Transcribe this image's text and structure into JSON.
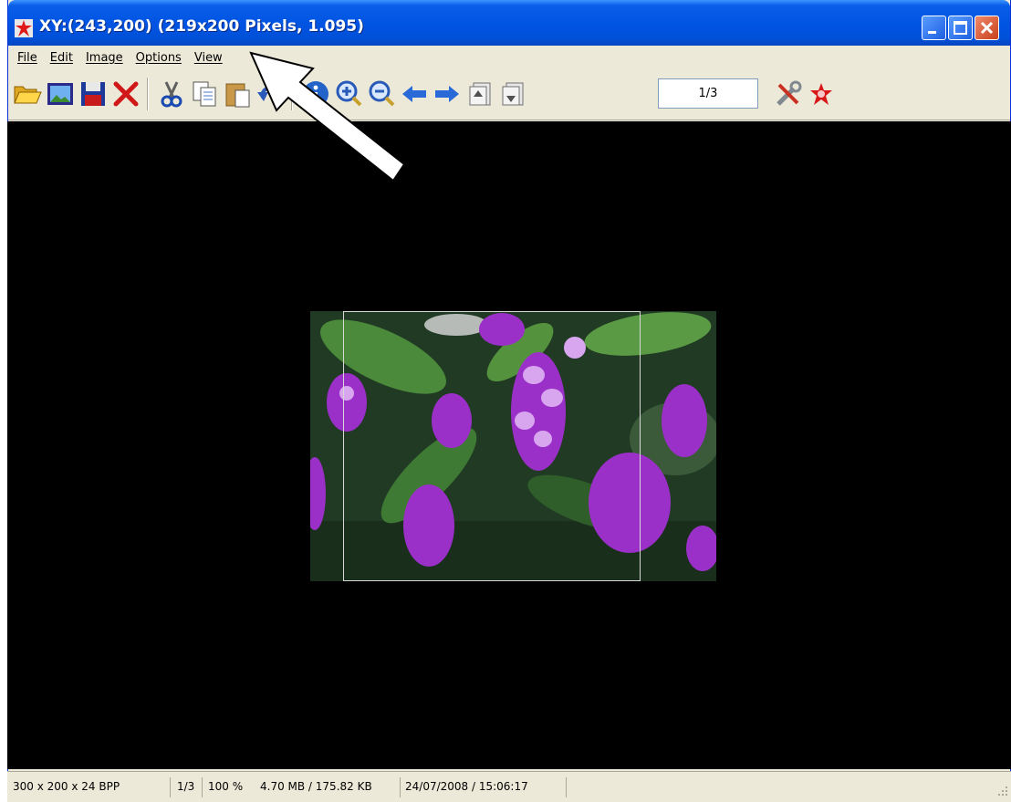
{
  "window": {
    "title": "XY:(243,200) (219x200 Pixels, 1.095)"
  },
  "menu": {
    "items": [
      {
        "label": "File"
      },
      {
        "label": "Edit"
      },
      {
        "label": "Image"
      },
      {
        "label": "Options"
      },
      {
        "label": "View"
      }
    ]
  },
  "toolbar": {
    "page_indicator": "1/3",
    "buttons": [
      "open-folder-icon",
      "slideshow-icon",
      "save-icon",
      "delete-icon",
      "cut-icon",
      "copy-icon",
      "paste-icon",
      "undo-icon",
      "info-icon",
      "zoom-in-icon",
      "zoom-out-icon",
      "previous-icon",
      "next-icon",
      "first-page-icon",
      "last-page-icon",
      "settings-icon",
      "exit-icon"
    ]
  },
  "statusbar": {
    "dimensions": "300 x 200 x 24 BPP",
    "page": "1/3",
    "zoom": "100 %",
    "memory": "4.70 MB / 175.82 KB",
    "datetime": "24/07/2008 / 15:06:17"
  },
  "colors": {
    "titlebar": "#0054e3",
    "canvas": "#000000",
    "chrome": "#ece9d8",
    "flower": "#9b30c8"
  }
}
